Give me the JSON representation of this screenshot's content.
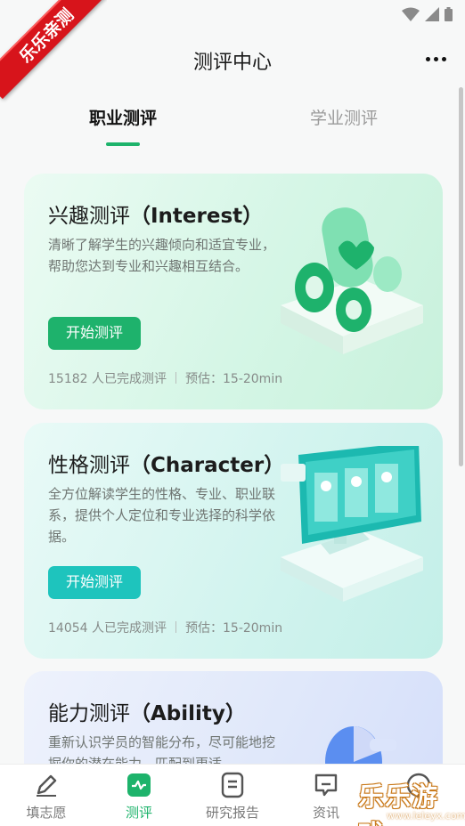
{
  "ribbon": {
    "text": "乐乐亲测"
  },
  "header": {
    "title": "测评中心",
    "more_icon": "more-dots-icon"
  },
  "tabs": [
    {
      "label": "职业测评",
      "active": true
    },
    {
      "label": "学业测评",
      "active": false
    }
  ],
  "cards": [
    {
      "title_cn": "兴趣测评",
      "title_en": "（Interest）",
      "desc": "清晰了解学生的兴趣倾向和适宜专业，帮助您达到专业和兴趣相互结合。",
      "button": "开始测评",
      "count": "15182 人已完成测评",
      "estimate": "预估：15-20min",
      "accent": "#1eb26c"
    },
    {
      "title_cn": "性格测评",
      "title_en": "（Character）",
      "desc": "全方位解读学生的性格、专业、职业联系，提供个人定位和专业选择的科学依据。",
      "button": "开始测评",
      "count": "14054 人已完成测评",
      "estimate": "预估：15-20min",
      "accent": "#1ec4bd"
    },
    {
      "title_cn": "能力测评",
      "title_en": "（Ability）",
      "desc": "重新认识学员的智能分布，尽可能地挖掘你的潜在能力，匹配到更适",
      "accent": "#4a7fe6"
    }
  ],
  "bottom_nav": [
    {
      "label": "填志愿",
      "icon": "pen-icon",
      "active": false
    },
    {
      "label": "测评",
      "icon": "assessment-icon",
      "active": true
    },
    {
      "label": "研究报告",
      "icon": "report-icon",
      "active": false
    },
    {
      "label": "资讯",
      "icon": "message-icon",
      "active": false
    },
    {
      "label": "",
      "icon": "profile-icon",
      "active": false
    }
  ],
  "watermark": {
    "text": "乐乐游戏",
    "url": "www.leleyx.com"
  },
  "colors": {
    "primary": "#1db36b",
    "teal": "#1ec4bd",
    "ribbon": "#d7141b"
  }
}
